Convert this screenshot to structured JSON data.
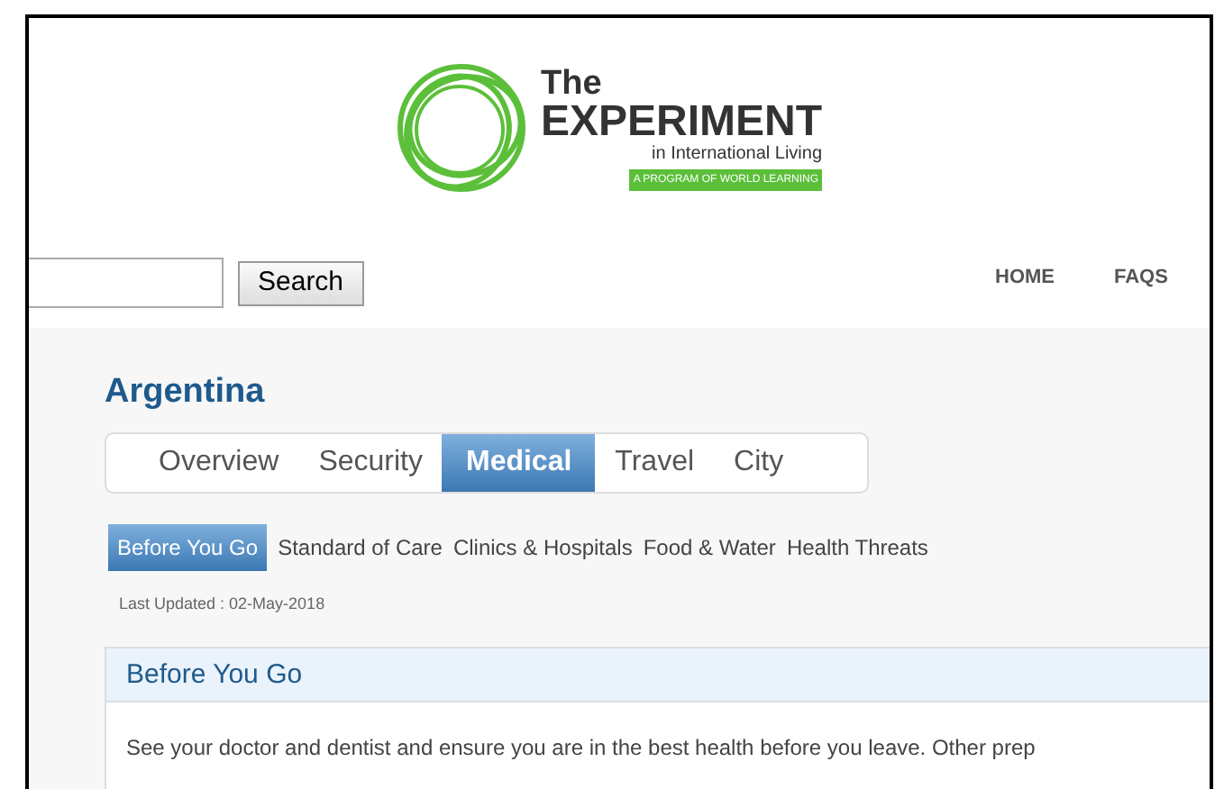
{
  "logo": {
    "line_1": "The",
    "line_2": "EXPERIMENT",
    "line_3": "in International Living",
    "tagline": "A PROGRAM OF WORLD LEARNING"
  },
  "search": {
    "button": "Search"
  },
  "nav": [
    "HOME",
    "FAQS"
  ],
  "country": "Argentina",
  "tabs": [
    {
      "label": "Overview",
      "selected": false
    },
    {
      "label": "Security",
      "selected": false
    },
    {
      "label": "Medical",
      "selected": true
    },
    {
      "label": "Travel",
      "selected": false
    },
    {
      "label": "City",
      "selected": false
    }
  ],
  "subtabs": [
    {
      "label": "Before You Go",
      "selected": true
    },
    {
      "label": "Standard of Care",
      "selected": false
    },
    {
      "label": "Clinics & Hospitals",
      "selected": false
    },
    {
      "label": "Food & Water",
      "selected": false
    },
    {
      "label": "Health Threats",
      "selected": false
    }
  ],
  "last_updated": "Last Updated : 02-May-2018",
  "panel": {
    "title": "Before You Go",
    "body": "See your doctor and dentist and ensure you are in the best health before you leave. Other prep"
  }
}
